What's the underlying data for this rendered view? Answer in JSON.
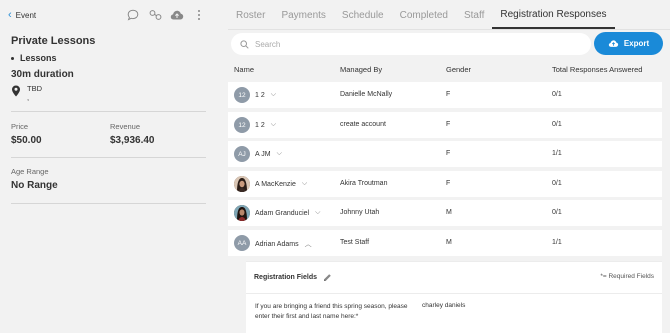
{
  "header": {
    "back_label": "Event"
  },
  "event": {
    "title": "Private Lessons",
    "category": "Lessons",
    "duration": "30m duration",
    "location_name": "TBD",
    "location_detail": ",",
    "price_label": "Price",
    "price_value": "$50.00",
    "revenue_label": "Revenue",
    "revenue_value": "$3,936.40",
    "age_label": "Age Range",
    "age_value": "No Range"
  },
  "tabs": [
    "Roster",
    "Payments",
    "Schedule",
    "Completed",
    "Staff",
    "Registration Responses"
  ],
  "active_tab": "Registration Responses",
  "search": {
    "placeholder": "Search"
  },
  "export_label": "Export",
  "table": {
    "headers": [
      "Name",
      "Managed By",
      "Gender",
      "Total Responses Answered"
    ],
    "rows": [
      {
        "initials": "12",
        "name": "1 2",
        "managed_by": "Danielle McNally",
        "gender": "F",
        "total": "0/1",
        "caret": "down"
      },
      {
        "initials": "12",
        "name": "1 2",
        "managed_by": "create account",
        "gender": "F",
        "total": "0/1",
        "caret": "down"
      },
      {
        "initials": "AJ",
        "name": "A JM",
        "managed_by": "",
        "gender": "F",
        "total": "1/1",
        "caret": "down"
      },
      {
        "initials": "",
        "name": "A MacKenzie",
        "managed_by": "Akira Troutman",
        "gender": "F",
        "total": "0/1",
        "caret": "down"
      },
      {
        "initials": "",
        "name": "Adam Granduciel",
        "managed_by": "Johnny Utah",
        "gender": "M",
        "total": "0/1",
        "caret": "down"
      },
      {
        "initials": "AA",
        "name": "Adrian Adams",
        "managed_by": "Test Staff",
        "gender": "M",
        "total": "1/1",
        "caret": "up"
      }
    ]
  },
  "registration": {
    "title": "Registration Fields",
    "required_note": "*= Required Fields",
    "question": "If you are bringing a friend this spring season, please enter their first and last name here:*",
    "answer": "charley daniels"
  },
  "colors": {
    "accent": "#1a8ad8",
    "avatar_bg": "#8f9ba8",
    "page_bg": "#f2f2f2"
  }
}
